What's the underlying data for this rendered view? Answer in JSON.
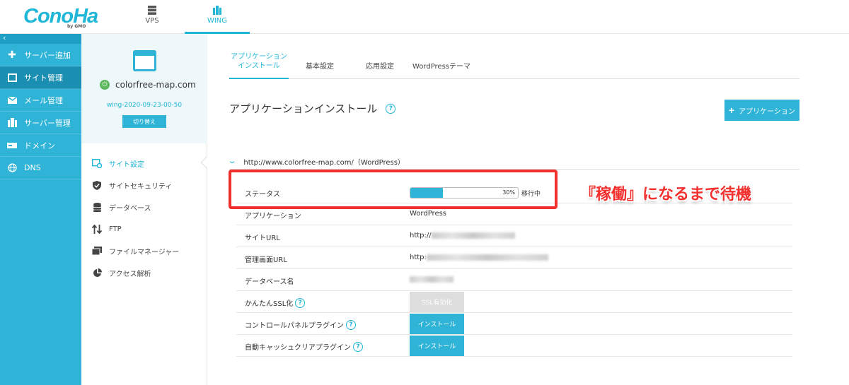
{
  "brand": {
    "logo_text": "ConoHa",
    "logo_sub": "by GMO"
  },
  "topnav": {
    "vps_label": "VPS",
    "wing_label": "WING"
  },
  "sidebar": {
    "collapse": "‹",
    "items": [
      {
        "label": "サーバー追加"
      },
      {
        "label": "サイト管理"
      },
      {
        "label": "メール管理"
      },
      {
        "label": "サーバー管理"
      },
      {
        "label": "ドメイン"
      },
      {
        "label": "DNS"
      }
    ]
  },
  "site": {
    "domain": "colorfree-map.com",
    "account": "wing-2020-09-23-00-50",
    "switch_label": "切り替え"
  },
  "site_menu": [
    {
      "label": "サイト設定"
    },
    {
      "label": "サイトセキュリティ"
    },
    {
      "label": "データベース"
    },
    {
      "label": "FTP"
    },
    {
      "label": "ファイルマネージャー"
    },
    {
      "label": "アクセス解析"
    }
  ],
  "tabs": [
    {
      "line1": "アプリケーション",
      "line2": "インストール"
    },
    {
      "label": "基本設定"
    },
    {
      "label": "応用設定"
    },
    {
      "label": "WordPressテーマ"
    }
  ],
  "page": {
    "title": "アプリケーションインストール",
    "add_button": "アプリケーション",
    "site_url_header": "http://www.colorfree-map.com/（WordPress）"
  },
  "details": {
    "status_label": "ステータス",
    "status_progress": 30,
    "status_percent": "30%",
    "status_text": "移行中",
    "app_label": "アプリケーション",
    "app_value": "WordPress",
    "siteurl_label": "サイトURL",
    "siteurl_value": "http://",
    "adminurl_label": "管理画面URL",
    "adminurl_value": "http:",
    "dbname_label": "データベース名",
    "ssl_label": "かんたんSSL化",
    "ssl_button": "SSL有効化",
    "cp_plugin_label": "コントロールパネルプラグイン",
    "cp_plugin_button": "インストール",
    "cache_plugin_label": "自動キャッシュクリアプラグイン",
    "cache_plugin_button": "インストール"
  },
  "annotation": {
    "text": "『稼働』になるまで待機",
    "color": "#f2302e"
  },
  "colors": {
    "accent": "#2fb3d6",
    "sidebar_active": "#1b8fb1"
  }
}
